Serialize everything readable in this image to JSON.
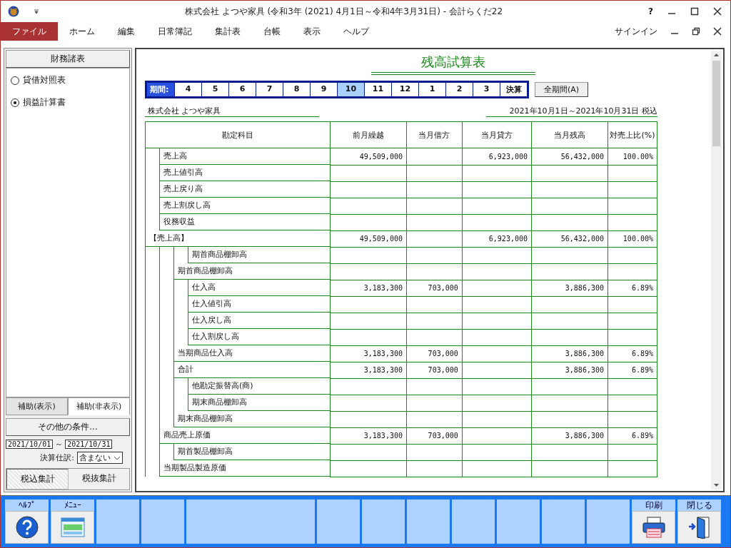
{
  "window": {
    "title": "株式会社  よつや家具 (令和3年 (2021) 4月1日～令和4年3月31日) - 会計らくだ22",
    "help": "?",
    "signin": "サインイン"
  },
  "menu": [
    {
      "label": "ファイル",
      "selected": true
    },
    {
      "label": "ホーム",
      "selected": false
    },
    {
      "label": "編集",
      "selected": false
    },
    {
      "label": "日常簿記",
      "selected": false
    },
    {
      "label": "集計表",
      "selected": false
    },
    {
      "label": "台帳",
      "selected": false
    },
    {
      "label": "表示",
      "selected": false
    },
    {
      "label": "ヘルプ",
      "selected": false
    }
  ],
  "sidebar": {
    "header": "財務諸表",
    "options": [
      {
        "label": "貸借対照表",
        "selected": false
      },
      {
        "label": "損益計算書",
        "selected": true
      }
    ],
    "sub_tabs": [
      {
        "label": "補助(表示)",
        "selected": false
      },
      {
        "label": "補助(非表示)",
        "selected": true
      }
    ],
    "conditions_button": "その他の条件...",
    "date_from": "2021/10/01",
    "date_sep": "～",
    "date_to": "2021/10/31",
    "closing_label": "決算仕訳:",
    "closing_value": "含まない",
    "tax_tabs": [
      {
        "label": "税込集計",
        "selected": true
      },
      {
        "label": "税抜集計",
        "selected": false
      }
    ]
  },
  "report": {
    "title": "残高試算表",
    "period_label": "期間:",
    "periods": [
      {
        "label": "4",
        "selected": false
      },
      {
        "label": "5",
        "selected": false
      },
      {
        "label": "6",
        "selected": false
      },
      {
        "label": "7",
        "selected": false
      },
      {
        "label": "8",
        "selected": false
      },
      {
        "label": "9",
        "selected": false
      },
      {
        "label": "10",
        "selected": true
      },
      {
        "label": "11",
        "selected": false
      },
      {
        "label": "12",
        "selected": false
      },
      {
        "label": "1",
        "selected": false
      },
      {
        "label": "2",
        "selected": false
      },
      {
        "label": "3",
        "selected": false
      },
      {
        "label": "決算",
        "selected": false
      }
    ],
    "all_periods_button": "全期間(A)",
    "company": "株式会社  よつや家具",
    "range": "2021年10月1日～2021年10月31日  税込",
    "columns": [
      "勘定科目",
      "前月繰越",
      "当月借方",
      "当月貸方",
      "当月残高",
      "対売上比(%)"
    ],
    "rows": [
      {
        "account": "【売上高】",
        "prev": "49,509,000",
        "credit": "6,923,000",
        "balance": "56,432,000",
        "ratio": "100.00%",
        "children": [
          {
            "account": "売上高",
            "prev": "49,509,000",
            "credit": "6,923,000",
            "balance": "56,432,000",
            "ratio": "100.00%"
          },
          {
            "account": "売上値引高"
          },
          {
            "account": "売上戻り高"
          },
          {
            "account": "売上割戻し高"
          },
          {
            "account": "役務収益"
          }
        ]
      },
      {
        "children": [
          {
            "account": "商品売上原価",
            "prev": "3,183,300",
            "debit": "703,000",
            "balance": "3,886,300",
            "ratio": "6.89%",
            "children": [
              {
                "account": "期首商品棚卸高",
                "children": [
                  {
                    "account": "期首商品棚卸高"
                  }
                ]
              },
              {
                "account": "当期商品仕入高",
                "prev": "3,183,300",
                "debit": "703,000",
                "balance": "3,886,300",
                "ratio": "6.89%",
                "children": [
                  {
                    "account": "仕入高",
                    "prev": "3,183,300",
                    "debit": "703,000",
                    "balance": "3,886,300",
                    "ratio": "6.89%"
                  },
                  {
                    "account": "仕入値引高"
                  },
                  {
                    "account": "仕入戻し高"
                  },
                  {
                    "account": "仕入割戻し高"
                  }
                ]
              },
              {
                "account": "合計",
                "prev": "3,183,300",
                "debit": "703,000",
                "balance": "3,886,300",
                "ratio": "6.89%"
              },
              {
                "account": "期末商品棚卸高",
                "children": [
                  {
                    "account": "他勘定振替高(商)"
                  },
                  {
                    "account": "期末商品棚卸高"
                  }
                ]
              }
            ]
          },
          {
            "account": "当期製品製造原価",
            "children": [
              {
                "account": "期首製品棚卸高"
              }
            ]
          }
        ]
      }
    ]
  },
  "toolbar": [
    {
      "kind": "help",
      "label": "ﾍﾙﾌﾟ"
    },
    {
      "kind": "menu",
      "label": "ﾒﾆｭｰ"
    },
    {
      "kind": "empty"
    },
    {
      "kind": "empty"
    },
    {
      "kind": "wide"
    },
    {
      "kind": "empty"
    },
    {
      "kind": "empty"
    },
    {
      "kind": "empty"
    },
    {
      "kind": "empty"
    },
    {
      "kind": "empty"
    },
    {
      "kind": "empty"
    },
    {
      "kind": "empty"
    },
    {
      "kind": "print",
      "label": "印刷"
    },
    {
      "kind": "close",
      "label": "閉じる"
    }
  ]
}
